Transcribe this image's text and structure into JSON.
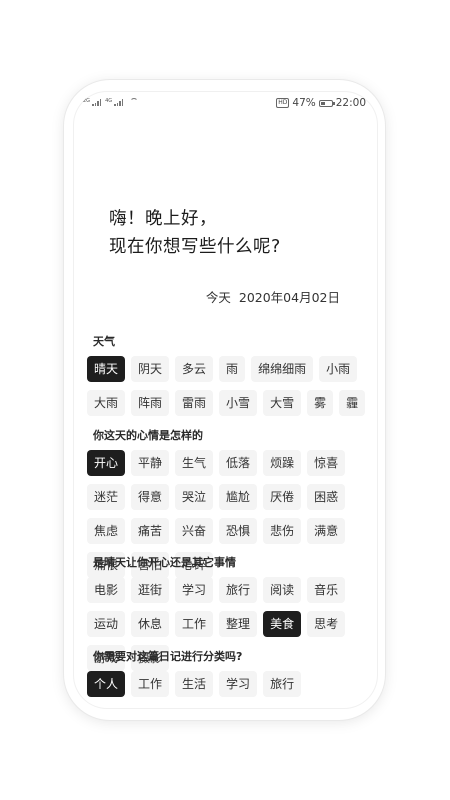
{
  "status": {
    "signal1_label": "2G",
    "signal2_label": "4G",
    "hd_badge": "HD",
    "battery_percent": "47%",
    "battery_level": 0.47,
    "time": "22:00"
  },
  "greeting": {
    "line1": "嗨！晚上好，",
    "line2": "现在你想写些什么呢?"
  },
  "date": {
    "today_label": "今天",
    "value": "2020年04月02日"
  },
  "weather": {
    "title": "天气",
    "options": [
      "晴天",
      "阴天",
      "多云",
      "雨",
      "绵绵细雨",
      "小雨",
      "大雨",
      "阵雨",
      "雷雨",
      "小雪",
      "大雪",
      "雾",
      "霾"
    ],
    "selected": "晴天"
  },
  "mood": {
    "title": "你这天的心情是怎样的",
    "options": [
      "开心",
      "平静",
      "生气",
      "低落",
      "烦躁",
      "惊喜",
      "迷茫",
      "得意",
      "哭泣",
      "尴尬",
      "厌倦",
      "困惑",
      "焦虑",
      "痛苦",
      "兴奋",
      "恐惧",
      "悲伤",
      "满意",
      "痛恨",
      "害怕",
      "心碎"
    ],
    "selected": "开心"
  },
  "reason": {
    "title": "是晴天让你开心还是其它事情",
    "options": [
      "电影",
      "逛街",
      "学习",
      "旅行",
      "阅读",
      "音乐",
      "运动",
      "休息",
      "工作",
      "整理",
      "美食",
      "思考",
      "游戏",
      "摄影"
    ],
    "selected": "美食"
  },
  "category": {
    "title": "你需要对这篇日记进行分类吗?",
    "options": [
      "个人",
      "工作",
      "生活",
      "学习",
      "旅行"
    ],
    "selected": "个人"
  }
}
